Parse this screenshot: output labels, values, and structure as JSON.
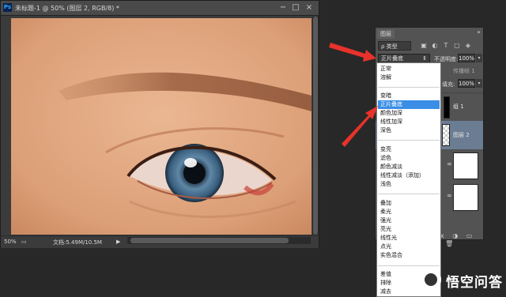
{
  "document": {
    "app_badge": "Ps",
    "title": "未标题-1 @ 50% (图层 2, RGB/8) *",
    "controls": [
      "−",
      "□",
      "×"
    ],
    "status": {
      "zoom": "50%",
      "doc_info": "文档:5.49M/10.5M",
      "nav_arrow": "▶"
    }
  },
  "layers_panel": {
    "tab": "图层",
    "close": "»",
    "filter": {
      "label": "ρ 类型",
      "icons": [
        "image-filter",
        "adjust-filter",
        "text-filter",
        "shape-filter",
        "smart-filter"
      ]
    },
    "filter_glyphs": [
      "▣",
      "◐",
      "T",
      "▢",
      "◈"
    ],
    "blend_mode": "正片叠底",
    "opacity_label": "不透明度:",
    "opacity_value": "100%",
    "lock_label": "传播帧 1",
    "fill_label": "填充:",
    "fill_value": "100%",
    "layers": [
      {
        "name": "组 1",
        "kind": "group"
      },
      {
        "name": "图层 2",
        "kind": "layer"
      },
      {
        "name": "",
        "kind": "layer"
      },
      {
        "name": "",
        "kind": "layer"
      }
    ],
    "footer_glyphs": "ⓕx ◑ ▭ ▬ 🗑"
  },
  "blend_menu": {
    "selected": "正片叠底",
    "groups": [
      [
        "正常",
        "溶解"
      ],
      [
        "变暗",
        "正片叠底",
        "颜色加深",
        "线性加深",
        "深色"
      ],
      [
        "变亮",
        "滤色",
        "颜色减淡",
        "线性减淡（添加）",
        "浅色"
      ],
      [
        "叠加",
        "柔光",
        "强光",
        "亮光",
        "线性光",
        "点光",
        "实色混合"
      ],
      [
        "差值",
        "排除",
        "减去"
      ]
    ]
  },
  "watermark": {
    "text": "悟空问答"
  },
  "colors": {
    "annotation_arrow": "#e8322b",
    "menu_highlight": "#3a8ee6",
    "panel_bg": "#535353"
  }
}
